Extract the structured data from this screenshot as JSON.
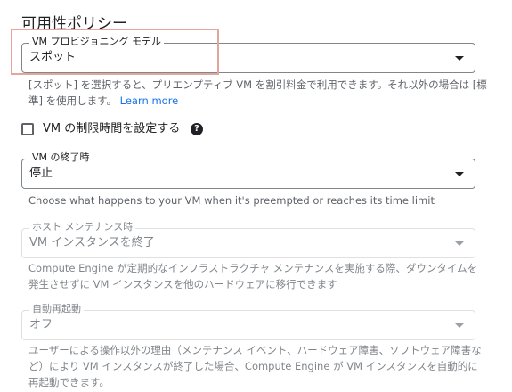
{
  "section_title": "可用性ポリシー",
  "provisioning_model": {
    "label": "VM プロビジョニング モデル",
    "value": "スポット",
    "hint_text": "[スポット] を選択すると、プリエンプティブ VM を割引料金で利用できます。それ以外の場合は [標準] を使用します。",
    "learn_more": "Learn more"
  },
  "time_limit": {
    "label": "VM の制限時間を設定する",
    "checked": false,
    "help_icon": "?"
  },
  "termination": {
    "label": "VM の終了時",
    "value": "停止",
    "hint_text": "Choose what happens to your VM when it's preempted or reaches its time limit"
  },
  "host_maintenance": {
    "label": "ホスト メンテナンス時",
    "value": "VM インスタンスを終了",
    "hint_text": "Compute Engine が定期的なインフラストラクチャ メンテナンスを実施する際、ダウンタイムを発生させずに VM インスタンスを他のハードウェアに移行できます"
  },
  "auto_restart": {
    "label": "自動再起動",
    "value": "オフ",
    "hint_text": "ユーザーによる操作以外の理由（メンテナンス イベント、ハードウェア障害、ソフトウェア障害など）により VM インスタンスが終了した場合、Compute Engine が VM インスタンスを自動的に再起動できます。"
  },
  "colors": {
    "highlight_box": "#e4a59c",
    "link": "#1a73e8"
  }
}
